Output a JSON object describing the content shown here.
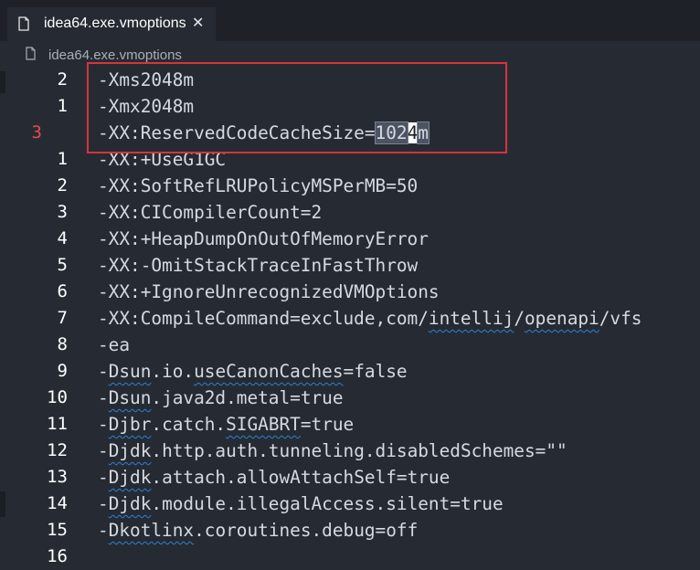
{
  "tab": {
    "title": "idea64.exe.vmoptions",
    "close_glyph": "✕",
    "file_icon": "file-icon"
  },
  "breadcrumb": {
    "file_icon": "file-icon",
    "text": "idea64.exe.vmoptions"
  },
  "lines": [
    {
      "num": "2",
      "parts": [
        {
          "t": "-Xms2048m"
        }
      ]
    },
    {
      "num": "1",
      "parts": [
        {
          "t": "-Xmx2048m"
        }
      ]
    },
    {
      "num": "3",
      "num_style": "red",
      "parts": [
        {
          "t": "-XX:ReservedCodeCacheSize="
        },
        {
          "t": "102",
          "style": "sel"
        },
        {
          "t": "4",
          "style": "cursor"
        },
        {
          "t": "m",
          "style": "sel"
        }
      ]
    },
    {
      "num": "1",
      "parts": [
        {
          "t": "-XX:+UseG1GC"
        }
      ]
    },
    {
      "num": "2",
      "parts": [
        {
          "t": "-XX:SoftRefLRUPolicyMSPerMB=50"
        }
      ]
    },
    {
      "num": "3",
      "parts": [
        {
          "t": "-XX:CICompilerCount=2"
        }
      ]
    },
    {
      "num": "4",
      "parts": [
        {
          "t": "-XX:+HeapDumpOnOutOfMemoryError"
        }
      ]
    },
    {
      "num": "5",
      "parts": [
        {
          "t": "-XX:-OmitStackTraceInFastThrow"
        }
      ]
    },
    {
      "num": "6",
      "parts": [
        {
          "t": "-XX:+IgnoreUnrecognizedVMOptions"
        }
      ]
    },
    {
      "num": "7",
      "parts": [
        {
          "t": "-XX:CompileCommand=exclude,com/"
        },
        {
          "t": "intellij",
          "style": "squig"
        },
        {
          "t": "/"
        },
        {
          "t": "openapi",
          "style": "squig"
        },
        {
          "t": "/vfs"
        }
      ]
    },
    {
      "num": "8",
      "parts": [
        {
          "t": "-ea"
        }
      ]
    },
    {
      "num": "9",
      "parts": [
        {
          "t": "-"
        },
        {
          "t": "Dsun",
          "style": "squig"
        },
        {
          "t": ".io."
        },
        {
          "t": "useCanonCaches",
          "style": "squig"
        },
        {
          "t": "=false"
        }
      ]
    },
    {
      "num": "10",
      "parts": [
        {
          "t": "-"
        },
        {
          "t": "Dsun",
          "style": "squig"
        },
        {
          "t": ".java2d.metal=true"
        }
      ]
    },
    {
      "num": "11",
      "parts": [
        {
          "t": "-"
        },
        {
          "t": "Djbr",
          "style": "squig"
        },
        {
          "t": ".catch."
        },
        {
          "t": "SIGABRT",
          "style": "squig"
        },
        {
          "t": "=true"
        }
      ]
    },
    {
      "num": "12",
      "parts": [
        {
          "t": "-"
        },
        {
          "t": "Djdk",
          "style": "squig"
        },
        {
          "t": ".http.auth.tunneling.disabledSchemes=\"\""
        }
      ]
    },
    {
      "num": "13",
      "parts": [
        {
          "t": "-"
        },
        {
          "t": "Djdk",
          "style": "squig"
        },
        {
          "t": ".attach.allowAttachSelf=true"
        }
      ]
    },
    {
      "num": "14",
      "parts": [
        {
          "t": "-"
        },
        {
          "t": "Djdk",
          "style": "squig"
        },
        {
          "t": ".module.illegalAccess.silent=true"
        }
      ]
    },
    {
      "num": "15",
      "parts": [
        {
          "t": "-"
        },
        {
          "t": "Dkotlinx",
          "style": "squig"
        },
        {
          "t": ".coroutines.debug=off"
        }
      ]
    },
    {
      "num": "16",
      "parts": [
        {
          "t": ""
        }
      ]
    }
  ],
  "colors": {
    "background": "#262b33",
    "tabbar": "#1e2228",
    "text": "#d6dae0",
    "line_number": "#ffffff",
    "relative_line_current": "#e8484e",
    "highlight_box": "#d8333b",
    "spell_squiggle": "#2f7fd6"
  }
}
